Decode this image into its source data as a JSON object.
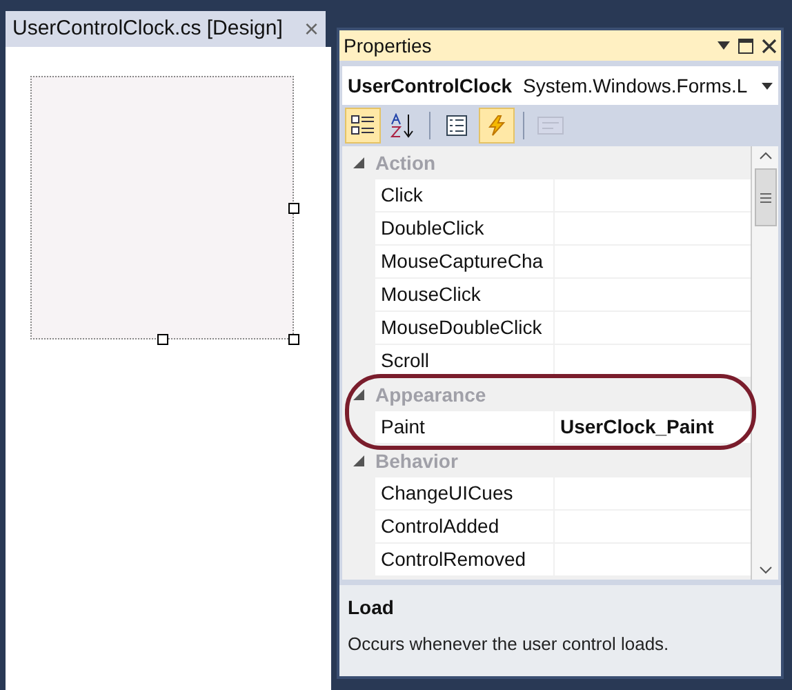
{
  "document_tab": {
    "title": "UserControlClock.cs [Design]",
    "close": "×"
  },
  "properties_window": {
    "title": "Properties",
    "object_selector": {
      "name": "UserControlClock",
      "type": "System.Windows.Forms.L"
    },
    "toolbar": [
      {
        "kind": "categorized",
        "selected": true,
        "disabled": false
      },
      {
        "kind": "alphabetical",
        "selected": false,
        "disabled": false
      },
      {
        "kind": "separator"
      },
      {
        "kind": "properties",
        "selected": false,
        "disabled": false
      },
      {
        "kind": "events",
        "selected": true,
        "disabled": false
      },
      {
        "kind": "separator"
      },
      {
        "kind": "property_pages",
        "selected": false,
        "disabled": true
      }
    ],
    "grid": [
      {
        "kind": "category",
        "name": "Action",
        "expanded": true
      },
      {
        "kind": "item",
        "name": "Click"
      },
      {
        "kind": "item",
        "name": "DoubleClick"
      },
      {
        "kind": "item",
        "name": "MouseCaptureCha"
      },
      {
        "kind": "item",
        "name": "MouseClick"
      },
      {
        "kind": "item",
        "name": "MouseDoubleClick"
      },
      {
        "kind": "item",
        "name": "Scroll"
      },
      {
        "kind": "category",
        "name": "Appearance",
        "expanded": true
      },
      {
        "kind": "item",
        "name": "Paint",
        "value": "UserClock_Paint"
      },
      {
        "kind": "category",
        "name": "Behavior",
        "expanded": true
      },
      {
        "kind": "item",
        "name": "ChangeUICues"
      },
      {
        "kind": "item",
        "name": "ControlAdded"
      },
      {
        "kind": "item",
        "name": "ControlRemoved"
      }
    ],
    "description": {
      "title": "Load",
      "text": "Occurs whenever the user control loads."
    }
  }
}
